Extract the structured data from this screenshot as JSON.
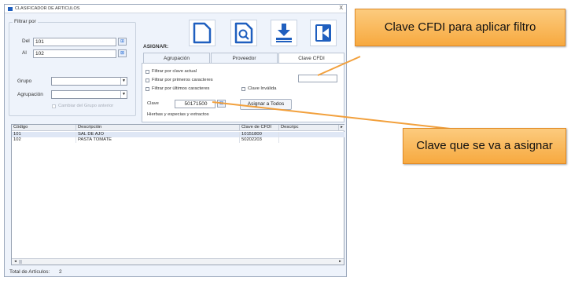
{
  "window": {
    "title": "CLASIFICADOR DE ARTICULOS",
    "close_glyph": "X"
  },
  "filter": {
    "group_label": "Filtrar por",
    "del_label": "Del",
    "del_value": "101",
    "al_label": "Al",
    "al_value": "102",
    "grupo_label": "Grupo",
    "grupo_value": "",
    "agrupacion_label": "Agrupación",
    "agrupacion_value": "",
    "clear_group_label": "Cambiar del Grupo anterior"
  },
  "assign": {
    "label": "ASIGNAR:",
    "tabs": [
      {
        "label": "Agrupación"
      },
      {
        "label": "Proveedor"
      },
      {
        "label": "Clave CFDI"
      }
    ],
    "active_tab": "Clave CFDI",
    "checks": {
      "actual": "Filtrar por clave actual",
      "primeros": "Filtrar por primeros caracteres",
      "ultimos": "Filtrar por últimos caracteres",
      "invalida": "Clave Inválida"
    },
    "filter_value": "",
    "clave_label": "Clave",
    "clave_value": "50171500",
    "assign_all_label": "Asignar a Todos",
    "clave_desc": "Hierbas y especias y extractos"
  },
  "grid": {
    "columns": [
      "Código",
      "Descripción",
      "Clave de CFDI",
      "Descripc"
    ],
    "rows": [
      {
        "codigo": "101",
        "descripcion": "SAL DE AJO",
        "clave": "10151800"
      },
      {
        "codigo": "102",
        "descripcion": "PASTA TOMATE",
        "clave": "50202203"
      }
    ]
  },
  "footer": {
    "total_label": "Total de Artículos:",
    "total_value": "2"
  },
  "callouts": {
    "top": "Clave CFDI para aplicar filtro",
    "bottom": "Clave que se va a asignar"
  },
  "colors": {
    "callout_fill": "#f9b857",
    "accent_blue": "#1f5fbf"
  }
}
